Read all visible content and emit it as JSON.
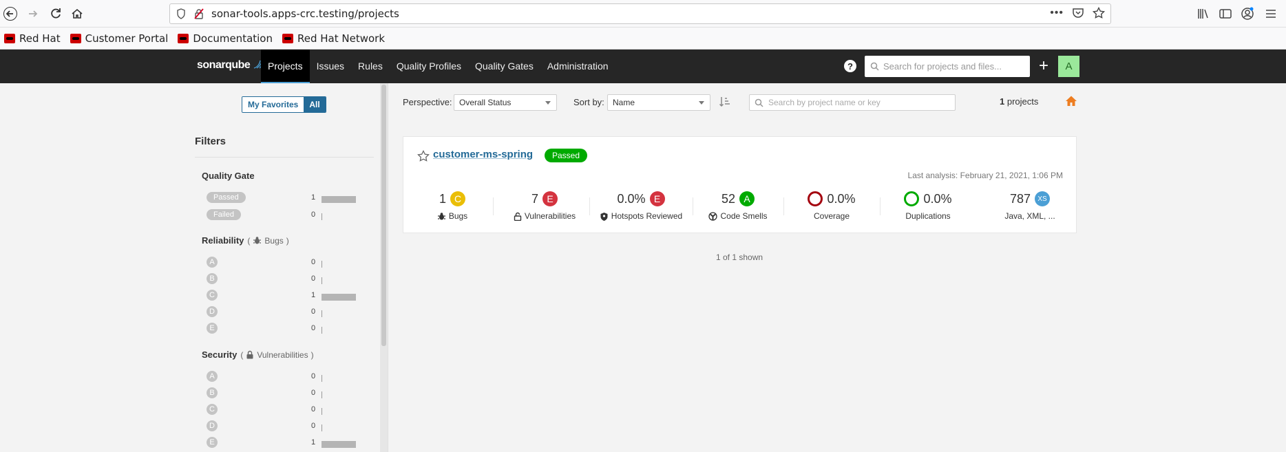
{
  "browser": {
    "url": "sonar-tools.apps-crc.testing/projects",
    "bookmarks": [
      "Red Hat",
      "Customer Portal",
      "Documentation",
      "Red Hat Network"
    ]
  },
  "header": {
    "logo": "sonarqube",
    "menu": [
      "Projects",
      "Issues",
      "Rules",
      "Quality Profiles",
      "Quality Gates",
      "Administration"
    ],
    "search_placeholder": "Search for projects and files...",
    "avatar": "A"
  },
  "sidebar": {
    "toggle": {
      "favorites": "My Favorites",
      "all": "All"
    },
    "filters_title": "Filters",
    "quality_gate": {
      "title": "Quality Gate",
      "rows": [
        {
          "label": "Passed",
          "count": "1",
          "fraction": 1
        },
        {
          "label": "Failed",
          "count": "0",
          "fraction": 0
        }
      ]
    },
    "reliability": {
      "title": "Reliability",
      "sub": "Bugs",
      "rows": [
        {
          "label": "A",
          "count": "0",
          "fraction": 0
        },
        {
          "label": "B",
          "count": "0",
          "fraction": 0
        },
        {
          "label": "C",
          "count": "1",
          "fraction": 1
        },
        {
          "label": "D",
          "count": "0",
          "fraction": 0
        },
        {
          "label": "E",
          "count": "0",
          "fraction": 0
        }
      ]
    },
    "security": {
      "title": "Security",
      "sub": "Vulnerabilities",
      "rows": [
        {
          "label": "A",
          "count": "0",
          "fraction": 0
        },
        {
          "label": "B",
          "count": "0",
          "fraction": 0
        },
        {
          "label": "C",
          "count": "0",
          "fraction": 0
        },
        {
          "label": "D",
          "count": "0",
          "fraction": 0
        },
        {
          "label": "E",
          "count": "1",
          "fraction": 1
        }
      ]
    }
  },
  "toolbar": {
    "perspective_label": "Perspective:",
    "perspective_value": "Overall Status",
    "sort_label": "Sort by:",
    "sort_value": "Name",
    "search_placeholder": "Search by project name or key",
    "count": "1",
    "count_suffix": " projects"
  },
  "project": {
    "name": "customer-ms-spring",
    "gate": "Passed",
    "last_analysis": "Last analysis: February 21, 2021, 1:06 PM",
    "measures": {
      "bugs": {
        "value": "1",
        "rating": "C",
        "label": "Bugs"
      },
      "vulnerabilities": {
        "value": "7",
        "rating": "E",
        "label": "Vulnerabilities"
      },
      "hotspots": {
        "value": "0.0%",
        "rating": "E",
        "label": "Hotspots Reviewed"
      },
      "code_smells": {
        "value": "52",
        "rating": "A",
        "label": "Code Smells"
      },
      "coverage": {
        "value": "0.0%",
        "label": "Coverage"
      },
      "duplications": {
        "value": "0.0%",
        "label": "Duplications"
      },
      "size": {
        "value": "787",
        "rating": "XS",
        "label": "Java, XML, ..."
      }
    }
  },
  "footer": {
    "shown": "1 of 1 shown"
  },
  "colors": {
    "passed": "#00aa00",
    "rating_a": "#00aa00",
    "rating_c": "#eabe06",
    "rating_e": "#d4333f",
    "size": "#4b9fd5",
    "link": "#236a97",
    "coverage_ring": "#a4030f",
    "duplications_ring": "#00aa00"
  }
}
